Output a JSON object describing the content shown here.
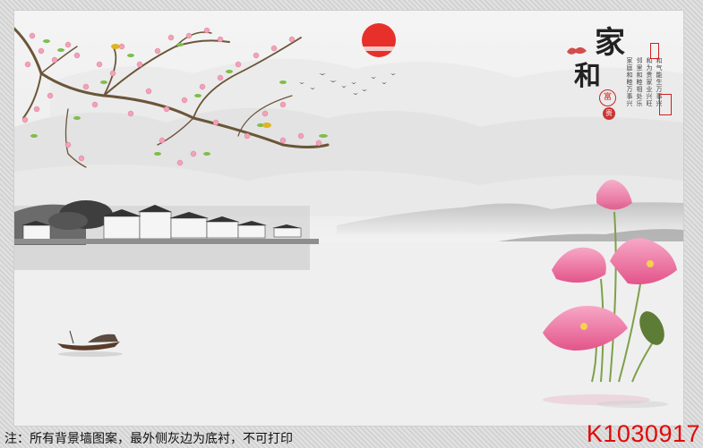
{
  "calligraphy": {
    "char_1": "家",
    "char_2": "和",
    "poem": [
      "和气能生万事兴",
      "和为贵家业兴旺",
      "邻里和睦相处乐",
      "家庭和睦万事兴"
    ],
    "seal_fu": "富",
    "seal_gui": "贵"
  },
  "footer": {
    "note": "注：所有背景墙图案，最外侧灰边为底衬，不可打印",
    "product_code": "K1030917"
  },
  "colors": {
    "code_red": "#e00a0a",
    "sun": "#e8302a",
    "blossom": "#f2a2b8",
    "lotus": "#ee6fa0"
  }
}
